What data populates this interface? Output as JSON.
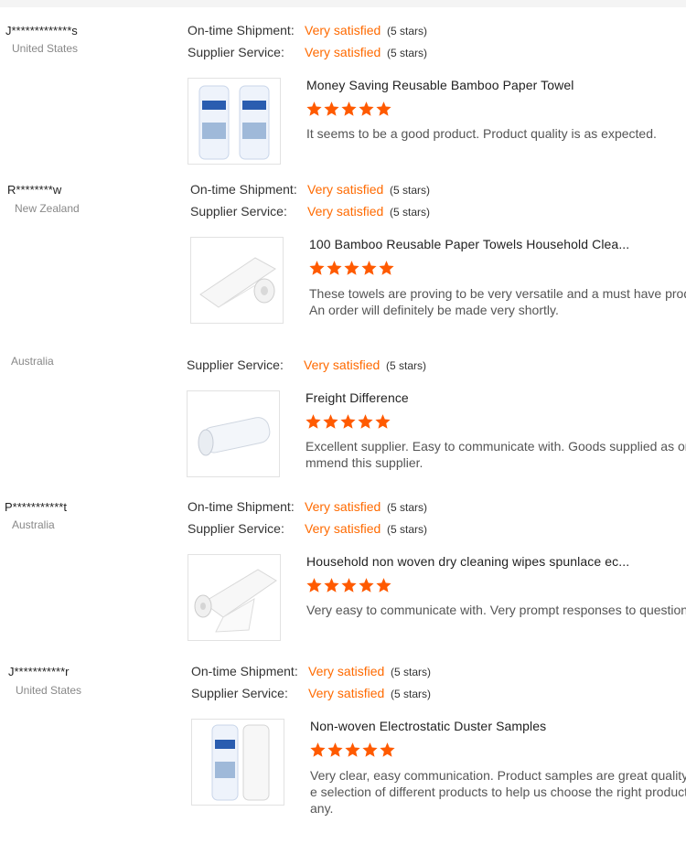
{
  "labels": {
    "shipment": "On-time Shipment:",
    "service": "Supplier Service:"
  },
  "star_color": "#ff5a00",
  "accent_color": "#ff6a00",
  "reviews": [
    {
      "buyer": "J*************s",
      "country": "United States",
      "shipment": {
        "value": "Very satisfied",
        "stars": "(5 stars)"
      },
      "service": {
        "value": "Very satisfied",
        "stars": "(5 stars)"
      },
      "product_title": "Money Saving Reusable Bamboo Paper Towel",
      "product_rating": 5,
      "comment_lines": [
        "It seems to be a good product.  Product quality is as expected."
      ],
      "image_icon": "paper-towel-pack-image"
    },
    {
      "buyer": "R********w",
      "country": "New Zealand",
      "shipment": {
        "value": "Very satisfied",
        "stars": "(5 stars)"
      },
      "service": {
        "value": "Very satisfied",
        "stars": "(5 stars)"
      },
      "product_title": "100 Bamboo Reusable Paper Towels Household Clea...",
      "product_rating": 5,
      "comment_lines": [
        "These towels are proving to be very versatile and a must have produc",
        "An order will definitely be made very shortly."
      ],
      "image_icon": "paper-towel-roll-image"
    },
    {
      "buyer": "",
      "country": "Australia",
      "service": {
        "value": "Very satisfied",
        "stars": "(5 stars)"
      },
      "product_title": "Freight Difference",
      "product_rating": 5,
      "comment_lines": [
        "Excellent supplier.  Easy to communicate with.  Goods supplied as or",
        "mmend this supplier."
      ],
      "image_icon": "wrapped-roll-image"
    },
    {
      "buyer": "P***********t",
      "country": "Australia",
      "shipment": {
        "value": "Very satisfied",
        "stars": "(5 stars)"
      },
      "service": {
        "value": "Very satisfied",
        "stars": "(5 stars)"
      },
      "product_title": "Household non woven dry cleaning wipes spunlace ec...",
      "product_rating": 5,
      "comment_lines": [
        "Very easy to communicate with.  Very prompt responses to questions"
      ],
      "image_icon": "paper-towel-roll-image"
    },
    {
      "buyer": "J***********r",
      "country": "United States",
      "shipment": {
        "value": "Very satisfied",
        "stars": "(5 stars)"
      },
      "service": {
        "value": "Very satisfied",
        "stars": "(5 stars)"
      },
      "product_title": "Non-woven Electrostatic Duster Samples",
      "product_rating": 5,
      "comment_lines": [
        "Very clear, easy communication. Product samples are great quality. .",
        "e selection of different products to help us choose the right product",
        "any."
      ],
      "image_icon": "paper-towel-pack-image"
    }
  ]
}
